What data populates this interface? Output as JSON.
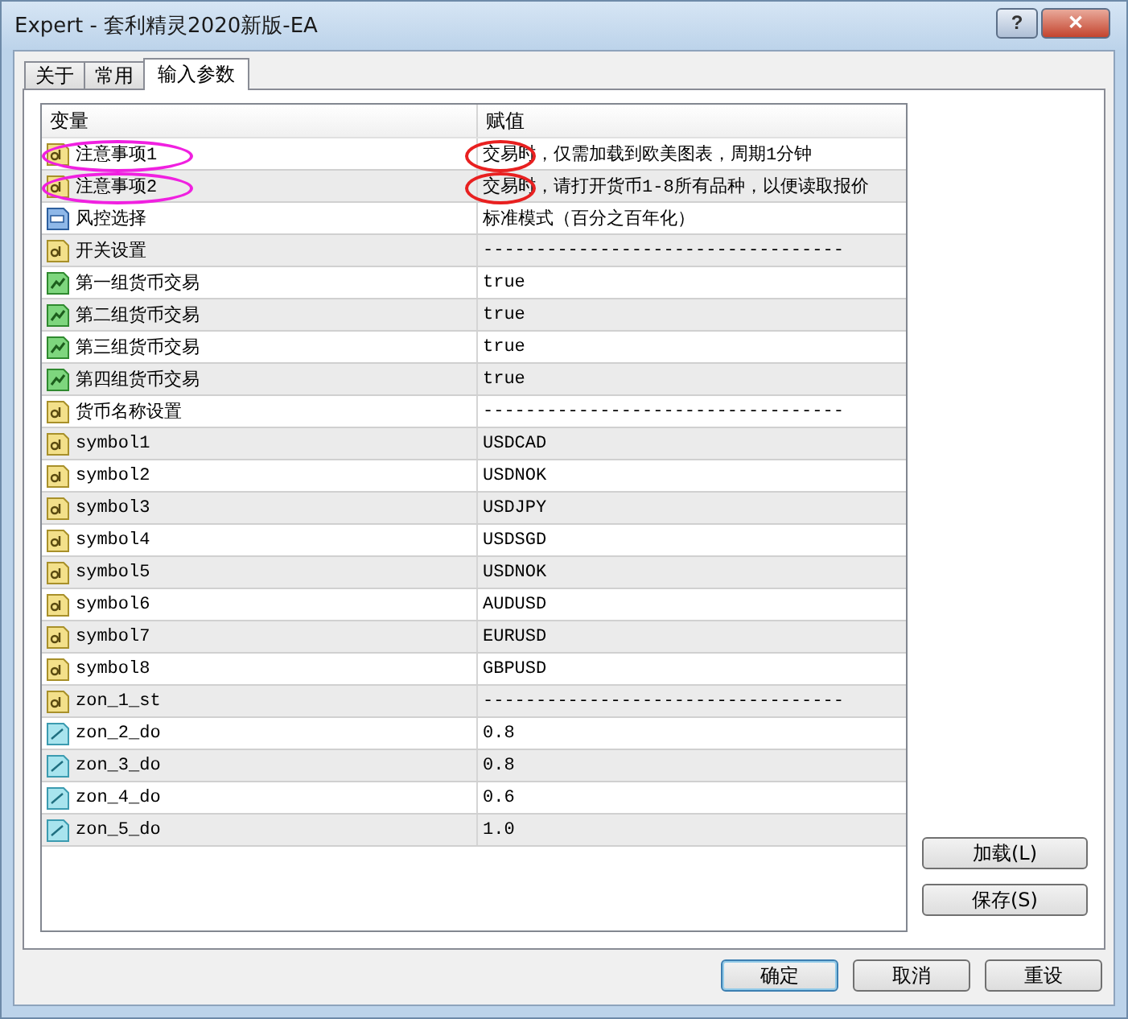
{
  "window": {
    "title": "Expert - 套利精灵2020新版-EA",
    "buttons": [
      "?",
      "✕"
    ]
  },
  "tabs": [
    {
      "label": "关于",
      "selected": false
    },
    {
      "label": "常用",
      "selected": false
    },
    {
      "label": "输入参数",
      "selected": true
    }
  ],
  "table": {
    "columns": [
      "变量",
      "赋值"
    ],
    "rows": [
      {
        "kind": "string",
        "name": "注意事项1",
        "value": "交易时，仅需加载到欧美图表，周期1分钟",
        "name_circled": true,
        "value_circled": true
      },
      {
        "kind": "string",
        "name": "注意事项2",
        "value": "交易时，请打开货币1-8所有品种，以便读取报价",
        "name_circled": true,
        "value_circled": true
      },
      {
        "kind": "int",
        "name": "风控选择",
        "value": "标准模式（百分之百年化）",
        "name_circled": false,
        "value_circled": false
      },
      {
        "kind": "string",
        "name": "开关设置",
        "value": "----------------------------------",
        "name_circled": false,
        "value_circled": false
      },
      {
        "kind": "bool",
        "name": "第一组货币交易",
        "value": "true",
        "name_circled": false,
        "value_circled": false
      },
      {
        "kind": "bool",
        "name": "第二组货币交易",
        "value": "true",
        "name_circled": false,
        "value_circled": false
      },
      {
        "kind": "bool",
        "name": "第三组货币交易",
        "value": "true",
        "name_circled": false,
        "value_circled": false
      },
      {
        "kind": "bool",
        "name": "第四组货币交易",
        "value": "true",
        "name_circled": false,
        "value_circled": false
      },
      {
        "kind": "string",
        "name": "货币名称设置",
        "value": "----------------------------------",
        "name_circled": false,
        "value_circled": false
      },
      {
        "kind": "string",
        "name": "symbol1",
        "value": "USDCAD",
        "name_circled": false,
        "value_circled": false
      },
      {
        "kind": "string",
        "name": "symbol2",
        "value": "USDNOK",
        "name_circled": false,
        "value_circled": false
      },
      {
        "kind": "string",
        "name": "symbol3",
        "value": "USDJPY",
        "name_circled": false,
        "value_circled": false
      },
      {
        "kind": "string",
        "name": "symbol4",
        "value": "USDSGD",
        "name_circled": false,
        "value_circled": false
      },
      {
        "kind": "string",
        "name": "symbol5",
        "value": "USDNOK",
        "name_circled": false,
        "value_circled": false
      },
      {
        "kind": "string",
        "name": "symbol6",
        "value": "AUDUSD",
        "name_circled": false,
        "value_circled": false
      },
      {
        "kind": "string",
        "name": "symbol7",
        "value": "EURUSD",
        "name_circled": false,
        "value_circled": false
      },
      {
        "kind": "string",
        "name": "symbol8",
        "value": "GBPUSD",
        "name_circled": false,
        "value_circled": false
      },
      {
        "kind": "string",
        "name": "zon_1_st",
        "value": "----------------------------------",
        "name_circled": false,
        "value_circled": false
      },
      {
        "kind": "double",
        "name": "zon_2_do",
        "value": "0.8",
        "name_circled": false,
        "value_circled": false
      },
      {
        "kind": "double",
        "name": "zon_3_do",
        "value": "0.8",
        "name_circled": false,
        "value_circled": false
      },
      {
        "kind": "double",
        "name": "zon_4_do",
        "value": "0.6",
        "name_circled": false,
        "value_circled": false
      },
      {
        "kind": "double",
        "name": "zon_5_do",
        "value": "1.0",
        "name_circled": false,
        "value_circled": false
      }
    ]
  },
  "side_buttons": [
    "加载(L)",
    "保存(S)"
  ],
  "footer_buttons": [
    {
      "label": "确定",
      "selected": true
    },
    {
      "label": "取消",
      "selected": false
    },
    {
      "label": "重设",
      "selected": false
    }
  ]
}
